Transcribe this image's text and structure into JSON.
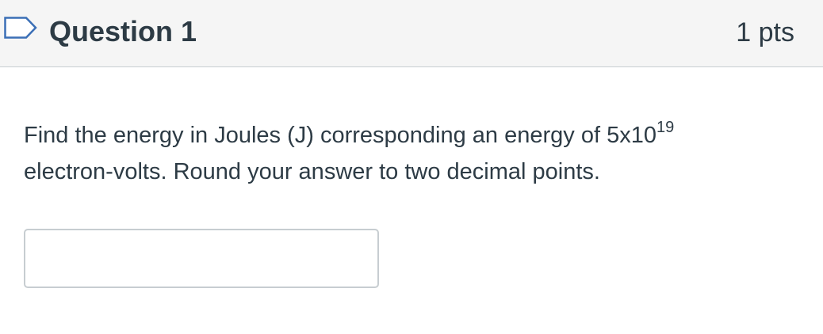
{
  "question": {
    "flag_icon": "bookmark-flag-outline-icon",
    "title": "Question 1",
    "points": "1 pts",
    "text_line1": "Find the energy in Joules (J) corresponding an energy of 5x10",
    "exponent": "19",
    "text_line2": "electron-volts. Round your answer to two decimal points.",
    "answer_value": "",
    "answer_placeholder": ""
  },
  "colors": {
    "header_bg": "#f5f5f5",
    "text": "#2d3b45",
    "flag": "#3b6fb6",
    "border": "#c7cdd1"
  }
}
